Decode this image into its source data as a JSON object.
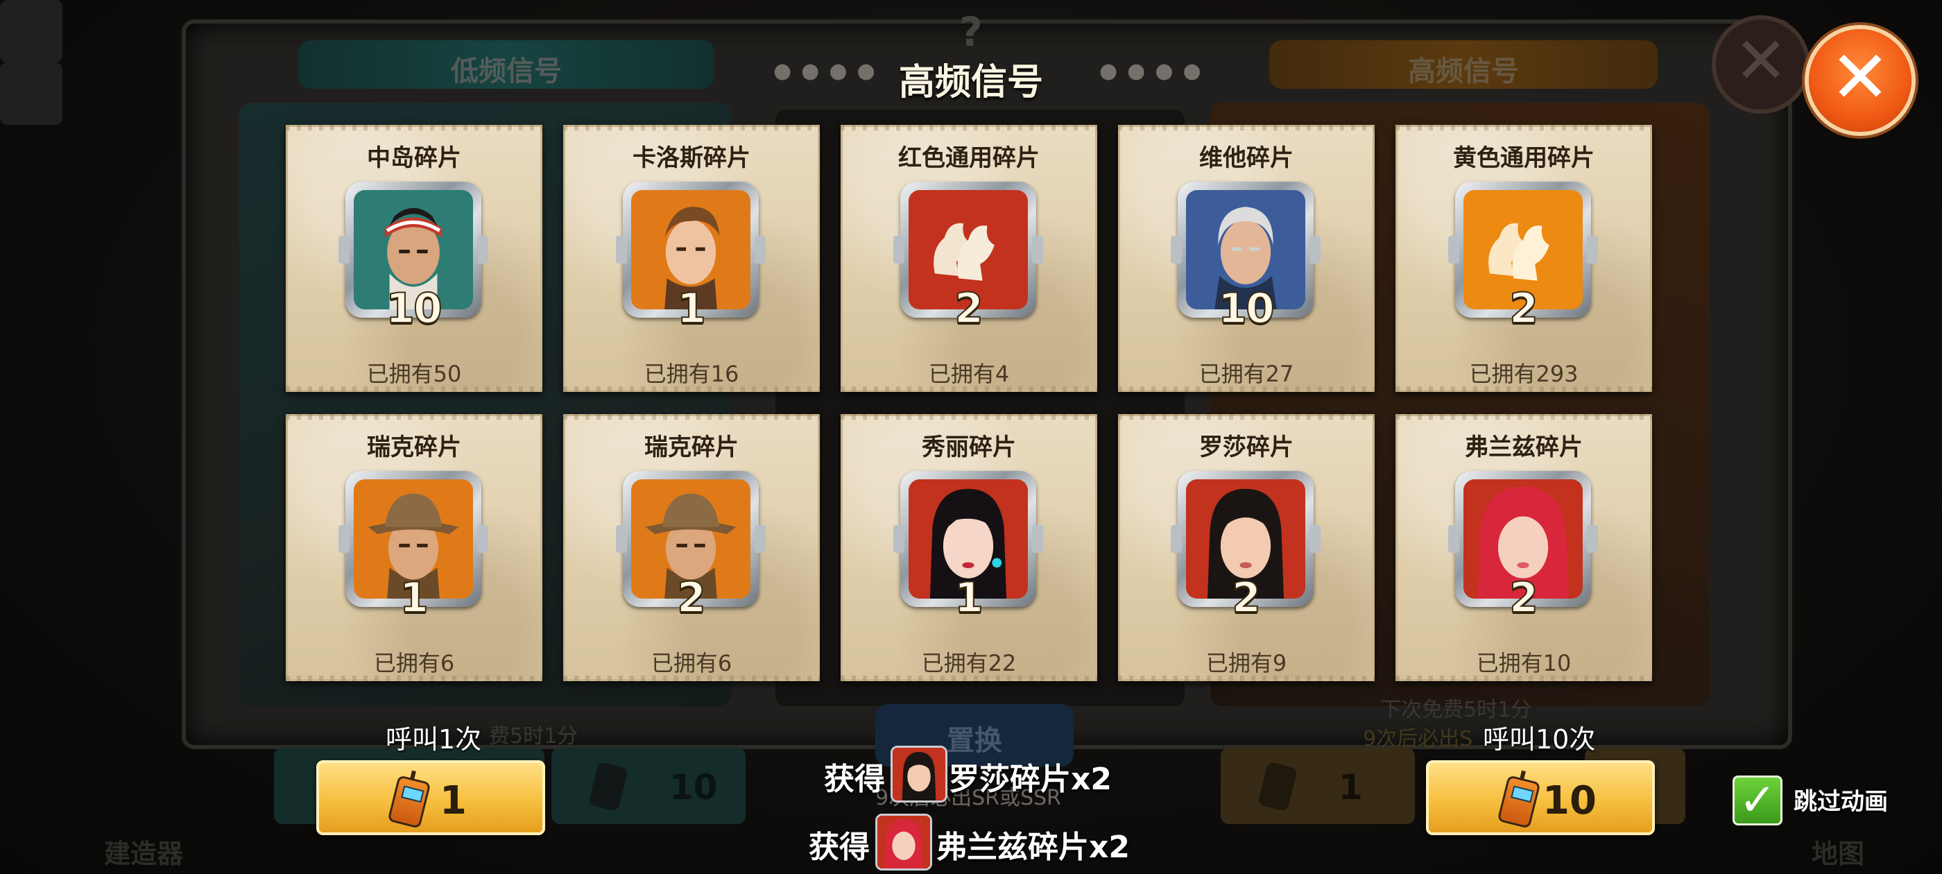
{
  "background": {
    "left_tab": "低频信号",
    "right_tab": "高频信号",
    "dim_question": "?",
    "dim_btn_cost": "10",
    "dim_btn_cost_single": "1",
    "corner_build": "建造器",
    "corner_map": "地图",
    "exchange": "置换",
    "next_free_left": "费5时1分",
    "next_free_right": "下次免费5时1分",
    "guarantee_right": "9次后必出S",
    "guarantee_mid": "9次后必出SR或SSR"
  },
  "result": {
    "title": "高频信号",
    "cards": [
      {
        "name": "中岛碎片",
        "count": "10",
        "owned": "已拥有50",
        "portrait": "nakajima-portrait",
        "bg": "#2d7d74"
      },
      {
        "name": "卡洛斯碎片",
        "count": "1",
        "owned": "已拥有16",
        "portrait": "carlos-portrait",
        "bg": "#e07a18"
      },
      {
        "name": "红色通用碎片",
        "count": "2",
        "owned": "已拥有4",
        "portrait": "red-universal-icon",
        "bg": "#c2321e"
      },
      {
        "name": "维他碎片",
        "count": "10",
        "owned": "已拥有27",
        "portrait": "vita-portrait",
        "bg": "#3c5d9a"
      },
      {
        "name": "黄色通用碎片",
        "count": "2",
        "owned": "已拥有293",
        "portrait": "yellow-universal-icon",
        "bg": "#ec8a12"
      },
      {
        "name": "瑞克碎片",
        "count": "1",
        "owned": "已拥有6",
        "portrait": "rick-portrait",
        "bg": "#e07a18"
      },
      {
        "name": "瑞克碎片",
        "count": "2",
        "owned": "已拥有6",
        "portrait": "rick-portrait",
        "bg": "#e07a18"
      },
      {
        "name": "秀丽碎片",
        "count": "1",
        "owned": "已拥有22",
        "portrait": "xiuli-portrait",
        "bg": "#c2321e"
      },
      {
        "name": "罗莎碎片",
        "count": "2",
        "owned": "已拥有9",
        "portrait": "rosa-portrait",
        "bg": "#c2321e"
      },
      {
        "name": "弗兰兹碎片",
        "count": "2",
        "owned": "已拥有10",
        "portrait": "franz-portrait",
        "bg": "#c2321e"
      }
    ]
  },
  "controls": {
    "call_once_label": "呼叫1次",
    "call_once_cost": "1",
    "call_ten_label": "呼叫10次",
    "call_ten_cost": "10",
    "skip_label": "跳过动画",
    "close_symbol": "✕",
    "check_symbol": "✓"
  },
  "obtained": [
    {
      "prefix": "获得",
      "item": "罗莎碎片x2",
      "portrait": "rosa-portrait"
    },
    {
      "prefix": "获得",
      "item": "弗兰兹碎片x2",
      "portrait": "franz-portrait"
    }
  ],
  "colors": {
    "accent_orange": "#f05a14",
    "button_gold": "#f7bf3e",
    "check_green": "#3b9a1b"
  }
}
